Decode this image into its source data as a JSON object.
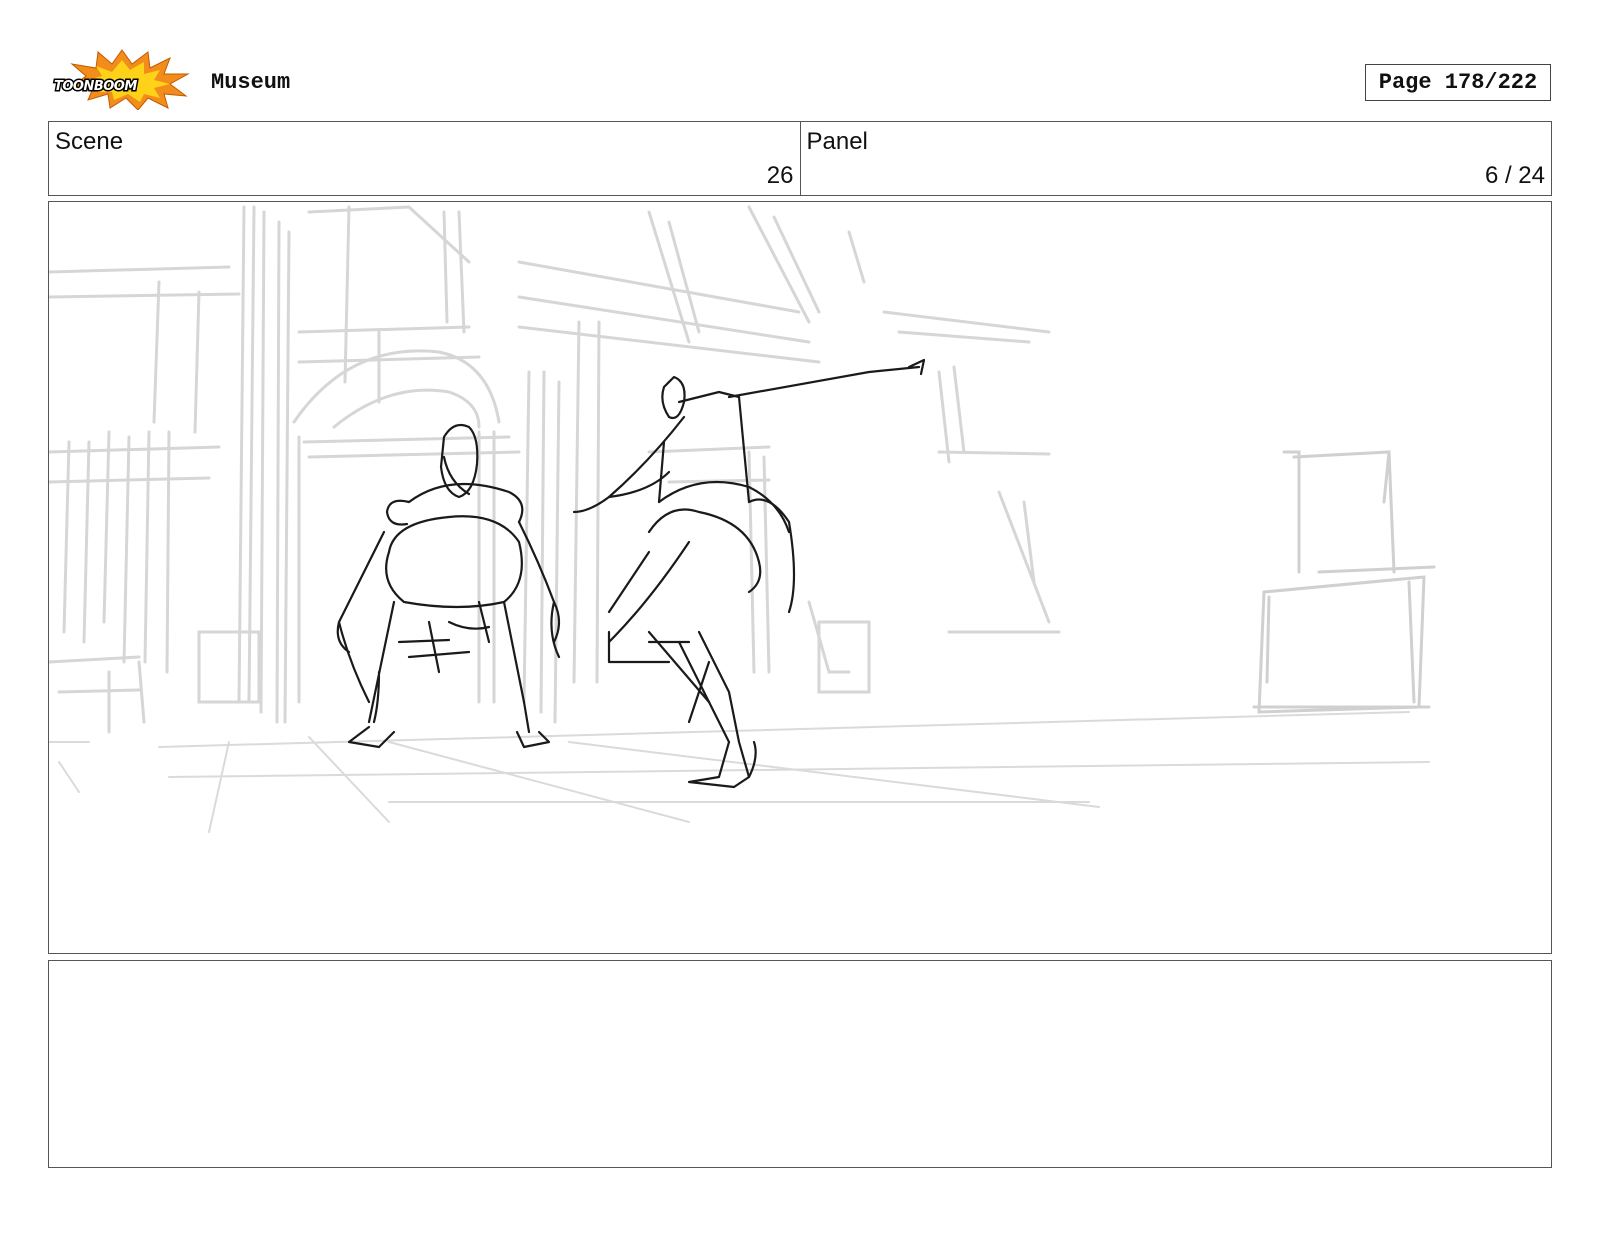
{
  "header": {
    "logo_text": "TOONBOOM",
    "project_title": "Museum",
    "page_label": "Page 178/222"
  },
  "info": {
    "scene_label": "Scene",
    "scene_value": "26",
    "panel_label": "Panel",
    "panel_value": "6 / 24"
  },
  "panel": {
    "drawing": "rough-sketch-two-figures-museum-hall"
  },
  "notes": {
    "text": ""
  },
  "colors": {
    "logo_orange": "#f28c1a",
    "logo_yellow": "#ffd21a",
    "border": "#555555",
    "sketch_light": "#d9d9d9",
    "sketch_dark": "#1a1a1a"
  }
}
